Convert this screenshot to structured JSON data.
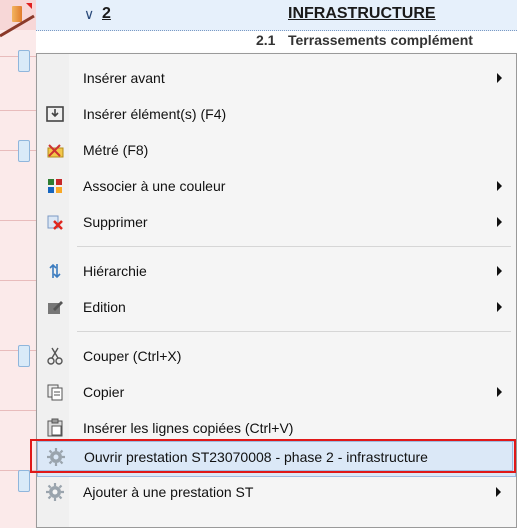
{
  "row": {
    "number": "2",
    "title": "INFRASTRUCTURE",
    "sub_number": "2.1",
    "sub_title": "Terrassements complément"
  },
  "menu": {
    "items": [
      {
        "label": "Insérer avant",
        "icon": "none",
        "submenu": true
      },
      {
        "label": "Insérer élément(s) (F4)",
        "icon": "insert-element-icon",
        "submenu": false
      },
      {
        "label": "Métré (F8)",
        "icon": "metre-ruler-icon",
        "submenu": false
      },
      {
        "label": "Associer à une couleur",
        "icon": "color-palette-icon",
        "submenu": true
      },
      {
        "label": "Supprimer",
        "icon": "delete-icon",
        "submenu": true
      },
      {
        "label": "Hiérarchie",
        "icon": "hierarchy-arrows-icon",
        "submenu": true
      },
      {
        "label": "Edition",
        "icon": "edit-icon",
        "submenu": true
      },
      {
        "label": "Couper (Ctrl+X)",
        "icon": "scissors-icon",
        "submenu": false
      },
      {
        "label": "Copier",
        "icon": "copy-icon",
        "submenu": true
      },
      {
        "label": "Insérer les lignes copiées (Ctrl+V)",
        "icon": "paste-icon",
        "submenu": false
      },
      {
        "label": "Ouvrir prestation ST23070008 - phase 2 - infrastructure",
        "icon": "gear-icon",
        "submenu": false
      },
      {
        "label": "Ajouter à une prestation ST",
        "icon": "gear-icon",
        "submenu": true
      }
    ]
  },
  "colors": {
    "highlight_border": "#e01818",
    "highlight_background": "#dbe8f7"
  }
}
